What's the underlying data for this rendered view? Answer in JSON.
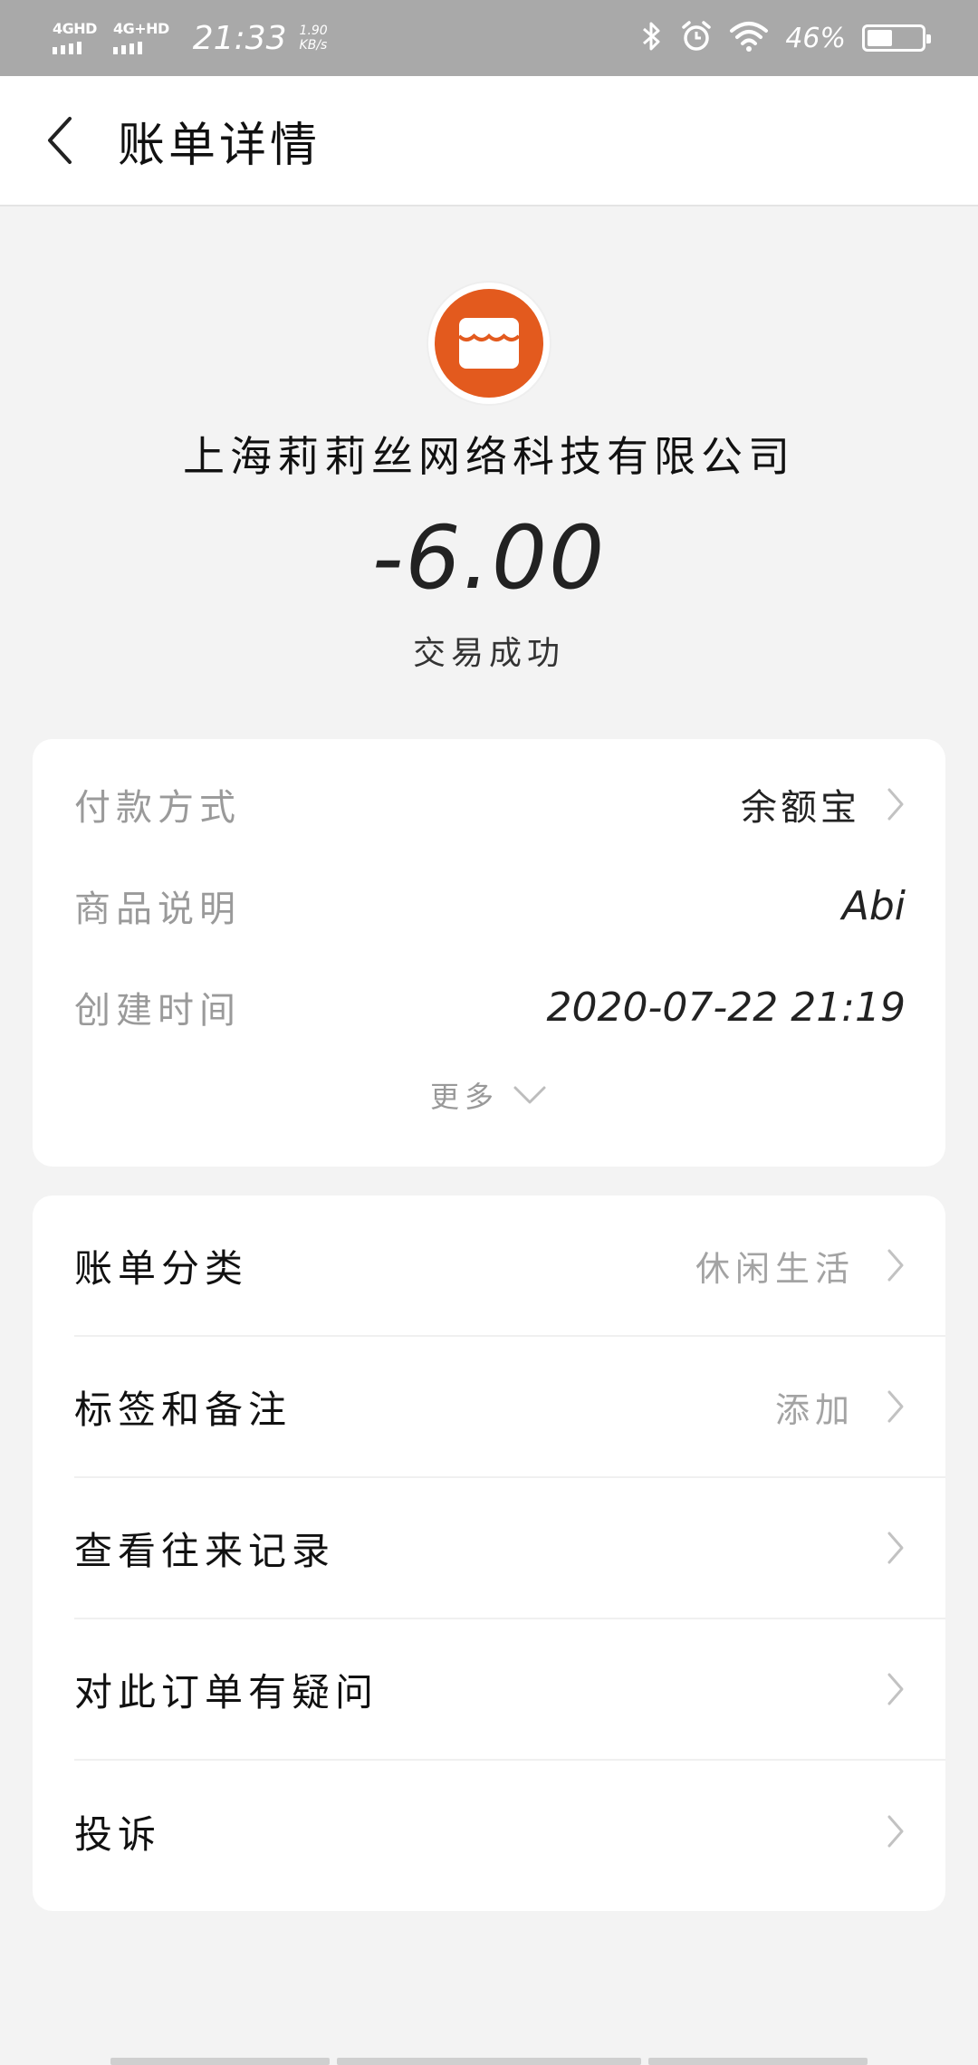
{
  "status_bar": {
    "network1": "4GHD",
    "network2": "4G+HD",
    "time": "21:33",
    "speed_value": "1.90",
    "speed_unit": "KB/s",
    "battery_pct": "46%",
    "battery_level": 0.46
  },
  "header": {
    "title": "账单详情"
  },
  "merchant": {
    "name": "上海莉莉丝网络科技有限公司",
    "amount": "-6.00",
    "status": "交易成功",
    "logo_color": "#e35a1e"
  },
  "details": {
    "payment_method": {
      "label": "付款方式",
      "value": "余额宝"
    },
    "product_desc": {
      "label": "商品说明",
      "value": "Abi"
    },
    "created_time": {
      "label": "创建时间",
      "value": "2020-07-22 21:19"
    },
    "more_label": "更多"
  },
  "menu": {
    "category": {
      "label": "账单分类",
      "value": "休闲生活"
    },
    "tags": {
      "label": "标签和备注",
      "value": "添加"
    },
    "history": {
      "label": "查看往来记录"
    },
    "question": {
      "label": "对此订单有疑问"
    },
    "complaint": {
      "label": "投诉"
    }
  }
}
